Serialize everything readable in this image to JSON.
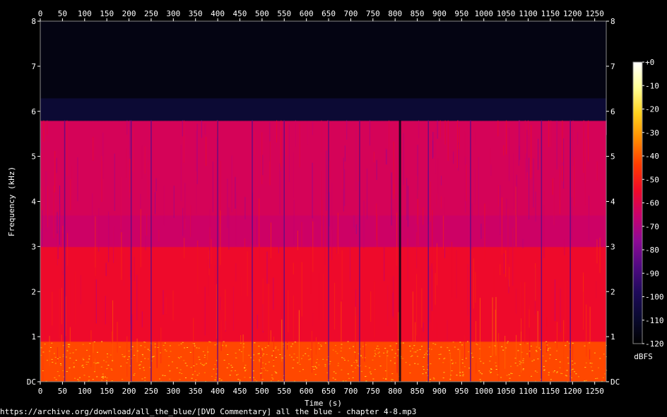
{
  "chart_data": {
    "type": "heatmap",
    "xlabel": "Time (s)",
    "ylabel": "Frequency (kHz)",
    "xlim": [
      0,
      1276
    ],
    "ylim": [
      0,
      8
    ],
    "x_ticks": [
      0,
      50,
      100,
      150,
      200,
      250,
      300,
      350,
      400,
      450,
      500,
      550,
      600,
      650,
      700,
      750,
      800,
      850,
      900,
      950,
      1000,
      1050,
      1100,
      1150,
      1200,
      1250
    ],
    "y_ticks": [
      {
        "value": 0,
        "label": "DC"
      },
      {
        "value": 1,
        "label": "1"
      },
      {
        "value": 2,
        "label": "2"
      },
      {
        "value": 3,
        "label": "3"
      },
      {
        "value": 4,
        "label": "4"
      },
      {
        "value": 5,
        "label": "5"
      },
      {
        "value": 6,
        "label": "6"
      },
      {
        "value": 7,
        "label": "7"
      },
      {
        "value": 8,
        "label": "8"
      }
    ],
    "colorbar": {
      "unit": "dBFS",
      "range": [
        -120,
        0
      ],
      "ticks": [
        "+0",
        "-10",
        "-20",
        "-30",
        "-40",
        "-50",
        "-60",
        "-70",
        "-80",
        "-90",
        "-100",
        "-110",
        "-120"
      ],
      "colors": [
        "#000000",
        "#0a0a30",
        "#1e0a5a",
        "#500a82",
        "#8c0a96",
        "#c8006e",
        "#f00a28",
        "#ff3c00",
        "#ff8c00",
        "#ffd21e",
        "#ffff96",
        "#ffffff"
      ]
    },
    "bands": [
      {
        "f_from": 0.0,
        "f_to": 0.9,
        "level_dbfs": -42
      },
      {
        "f_from": 0.9,
        "f_to": 3.0,
        "level_dbfs": -55
      },
      {
        "f_from": 3.0,
        "f_to": 3.7,
        "level_dbfs": -64
      },
      {
        "f_from": 3.7,
        "f_to": 5.8,
        "level_dbfs": -62
      },
      {
        "f_from": 5.8,
        "f_to": 6.3,
        "level_dbfs": -108
      },
      {
        "f_from": 6.3,
        "f_to": 8.0,
        "level_dbfs": -116
      }
    ],
    "dropouts_s": [
      55,
      205,
      250,
      400,
      478,
      550,
      650,
      720,
      811,
      875,
      970,
      1130,
      1195
    ],
    "lowpass_cutoff_khz": 5.8
  },
  "source": "https://archive.org/download/all_the_blue/[DVD Commentary] all the blue - chapter 4-8.mp3"
}
